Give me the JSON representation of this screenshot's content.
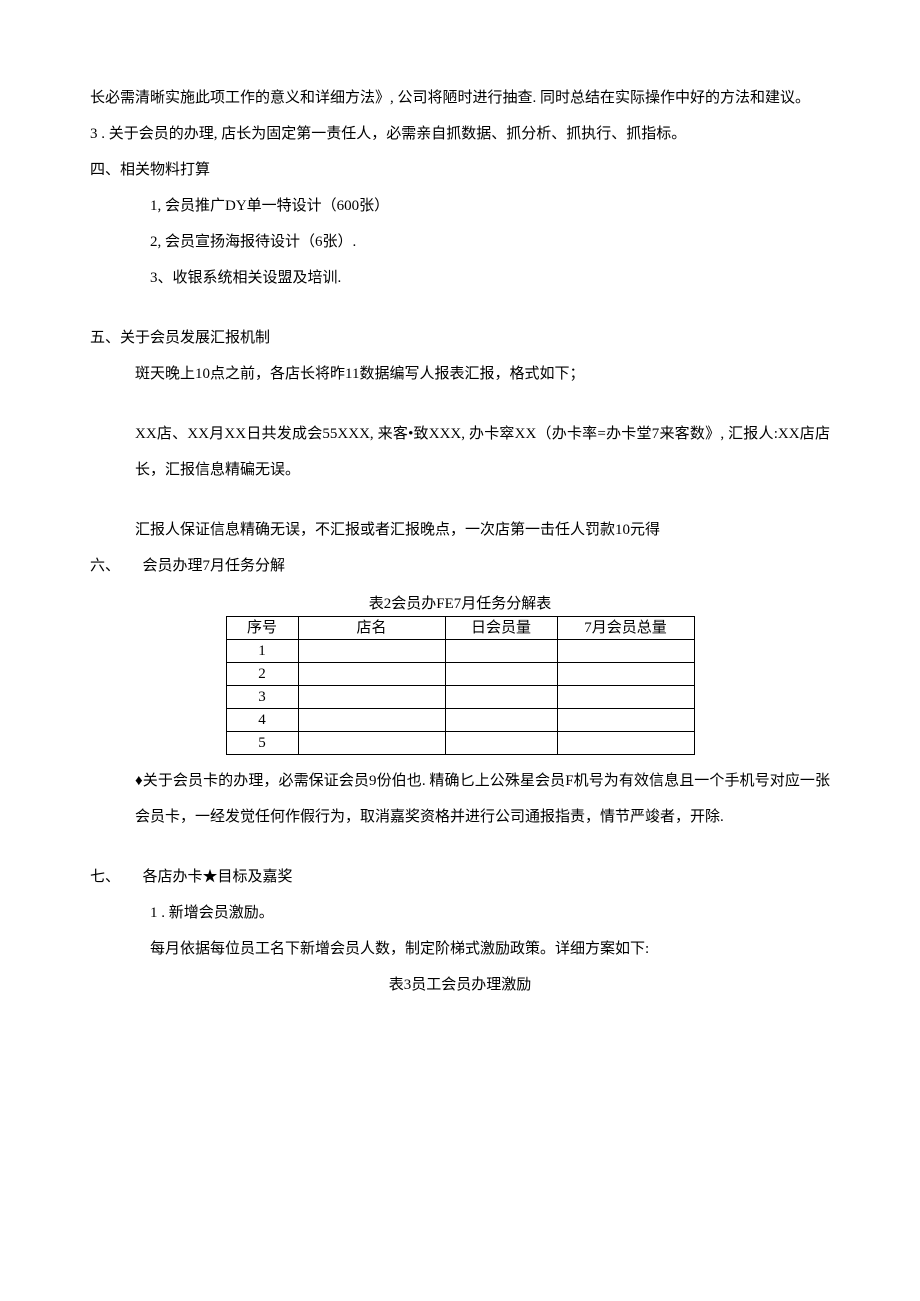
{
  "p1": "长必需清晰实施此项工作的意义和详细方法》, 公司将陋时进行抽查. 同时总结在实际操作中好的方法和建议。",
  "p2": "3  . 关于会员的办理, 店长为固定第一责任人，必需亲自抓数据、抓分析、抓执行、抓指标。",
  "p3": "四、相关物料打算",
  "p4": "1, 会员推广DY单一特设计（600张）",
  "p5": "2, 会员宣扬海报待设计（6张）.",
  "p6": "3、收银系统相关设盟及培训.",
  "p7": "五、关于会员发展汇报机制",
  "p8": "斑天晚上10点之前，各店长将昨11数据编写人报表汇报，格式如下；",
  "p9": "XX店、XX月XX日共发成会55XXX, 来客•致XXX, 办卡窣XX（办卡率=办卡堂7来客数》, 汇报人:XX店店长，汇报信息精碥无误。",
  "p10": "汇报人保证信息精确无误，不汇报或者汇报晚点，一次店第一击任人罚款10元得",
  "p11": "六、　　会员办理7月任务分解",
  "table2_caption": "表2会员办FE7月任务分解表",
  "table2": {
    "headers": {
      "c1": "序号",
      "c2": "店名",
      "c3": "日会员量",
      "c4": "7月会员总量"
    },
    "rows": [
      {
        "seq": "1",
        "name": "",
        "daily": "",
        "total": ""
      },
      {
        "seq": "2",
        "name": "",
        "daily": "",
        "total": ""
      },
      {
        "seq": "3",
        "name": "",
        "daily": "",
        "total": ""
      },
      {
        "seq": "4",
        "name": "",
        "daily": "",
        "total": ""
      },
      {
        "seq": "5",
        "name": "",
        "daily": "",
        "total": ""
      }
    ]
  },
  "p12": "♦关于会员卡的办理，必需保证会员9份伯也. 精确匕上公殊星会员F机号为有效信息且一个手机号对应一张会员卡，一经发觉任何作假行为，取消嘉奖资格并进行公司通报指责，情节严竣者，开除.",
  "p13": "七、　　各店办卡★目标及嘉奖",
  "p14": "1  . 新增会员激励。",
  "p15": "每月依据每位员工名下新增会员人数，制定阶梯式激励政策。详细方案如下:",
  "p16": "表3员工会员办理激励"
}
